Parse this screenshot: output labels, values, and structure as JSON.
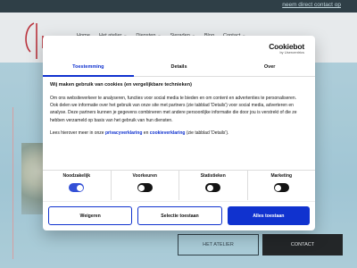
{
  "topbar": {
    "contact_link": "neem direct contact op"
  },
  "nav": {
    "items": [
      {
        "label": "Home",
        "caret": false
      },
      {
        "label": "Het atelier",
        "caret": true
      },
      {
        "label": "Diensten",
        "caret": true
      },
      {
        "label": "Sieraden",
        "caret": true
      },
      {
        "label": "Blog",
        "caret": false
      },
      {
        "label": "Contact",
        "caret": true
      }
    ]
  },
  "hero": {
    "atelier_button": "HET ATELIER",
    "contact_button": "CONTACT"
  },
  "cookie": {
    "brand": "Cookiebot",
    "brand_sub": "by Usercentrics",
    "tabs": [
      {
        "label": "Toestemming",
        "active": true
      },
      {
        "label": "Details",
        "active": false
      },
      {
        "label": "Over",
        "active": false
      }
    ],
    "heading": "Wij maken gebruik van cookies (en vergelijkbare technieken)",
    "paragraph": "Om ons websiteverkeer te analyseren, functies voor social media te bieden en om content en advertenties te personaliseren. Ook delen we informatie over het gebruik van onze site met partners (zie tabblad 'Details') voor social media, adverteren en analyse. Deze partners kunnen je gegevens combineren met andere persoonlijke informatie die door jou is verstrekt of die ze hebben verzameld op basis van het gebruik van hun diensten.",
    "more_prefix": "Lees hierover meer in onze ",
    "privacy_link": "privacyverklaring",
    "more_middle": " en ",
    "cookie_link": "cookieverklaring",
    "more_suffix": " (zie tabblad 'Details').",
    "toggles": [
      {
        "label": "Noodzakelijk",
        "state": "on"
      },
      {
        "label": "Voorkeuren",
        "state": "off"
      },
      {
        "label": "Statistieken",
        "state": "off"
      },
      {
        "label": "Marketing",
        "state": "off"
      }
    ],
    "buttons": {
      "deny": "Weigeren",
      "allow_selection": "Selectie toestaan",
      "allow_all": "Alles toestaan"
    }
  },
  "colors": {
    "accent": "#1032cf",
    "dark": "#141414",
    "hero_bg": "#b9dce8"
  }
}
